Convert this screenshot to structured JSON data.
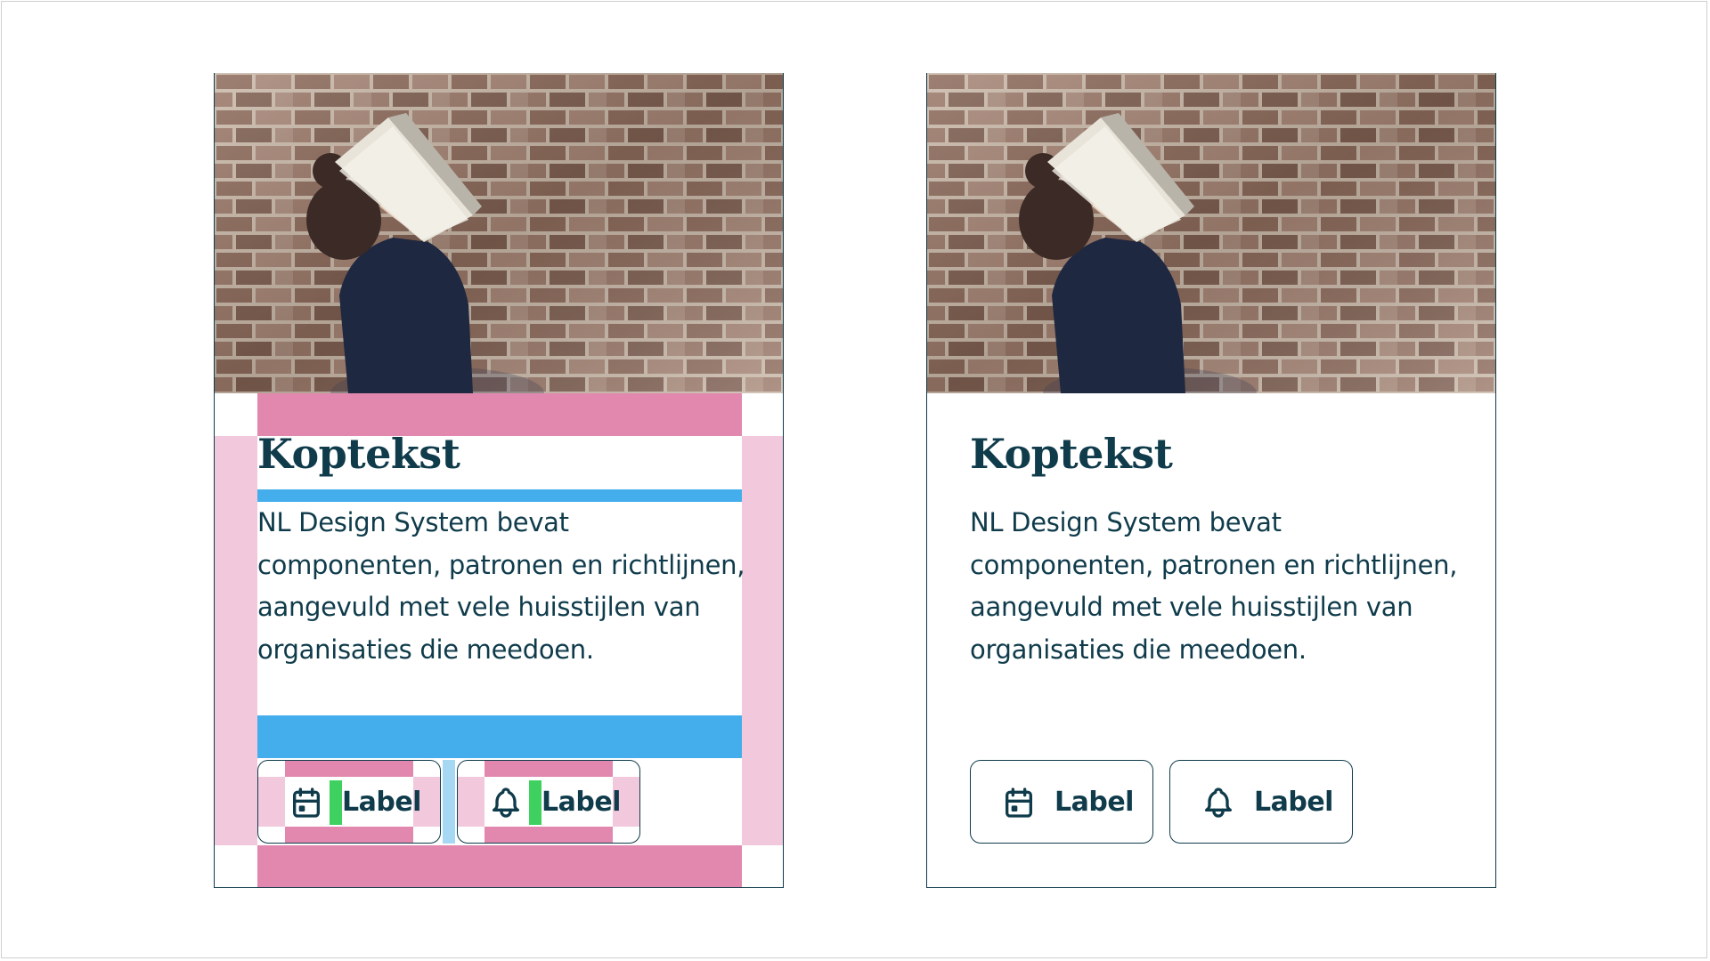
{
  "cards": [
    {
      "variant": "annotated",
      "heading": "Koptekst",
      "body": "NL Design System bevat componenten, patronen en richtlijnen, aangevuld met vele huisstijlen van organisaties die meedoen.",
      "buttons": [
        {
          "label": "Label",
          "icon": "calendar-icon"
        },
        {
          "label": "Label",
          "icon": "bell-icon"
        }
      ]
    },
    {
      "variant": "plain",
      "heading": "Koptekst",
      "body": "NL Design System bevat componenten, patronen en richtlijnen, aangevuld met vele huisstijlen van organisaties die meedoen.",
      "buttons": [
        {
          "label": "Label",
          "icon": "calendar-icon"
        },
        {
          "label": "Label",
          "icon": "bell-icon"
        }
      ]
    }
  ],
  "colors": {
    "text": "#0f3b4b",
    "padding_overlay": "#e288af",
    "padding_overlay_light": "#f2c9dc",
    "gap_overlay": "#44aeed",
    "icon_gap_overlay": "#3ed160"
  }
}
